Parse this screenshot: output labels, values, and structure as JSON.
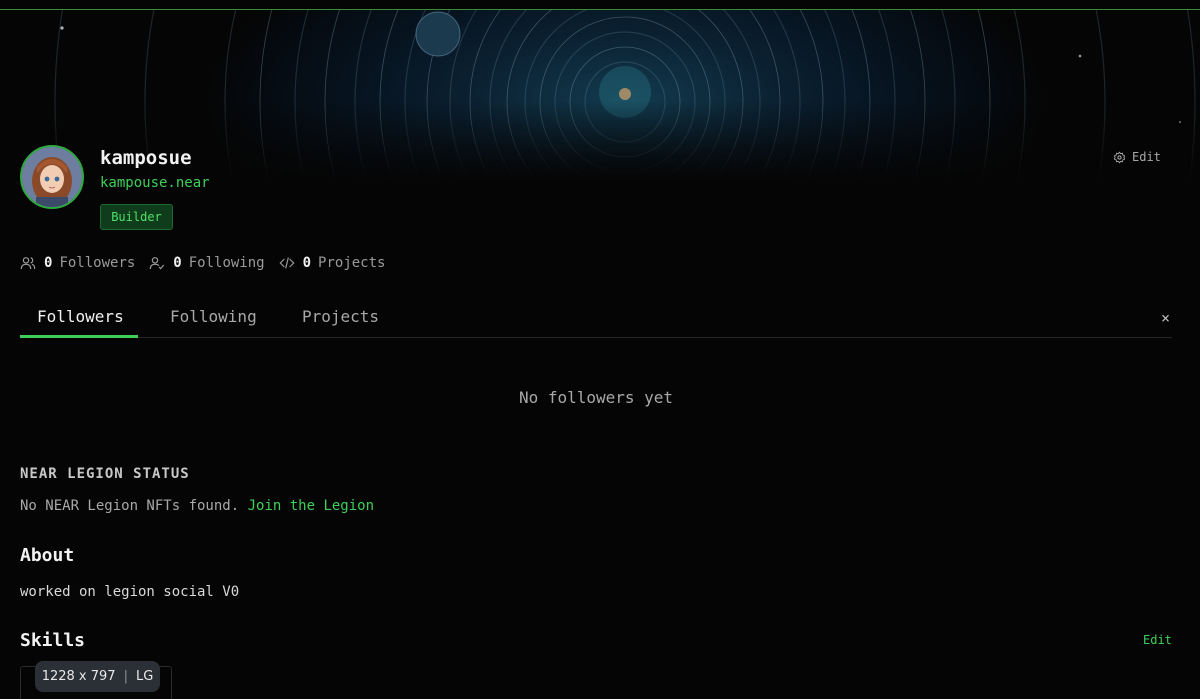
{
  "profile": {
    "username": "kamposue",
    "account_id": "kampouse.near",
    "badge": "Builder",
    "edit_label": "Edit"
  },
  "stats": {
    "followers_count": "0",
    "followers_label": "Followers",
    "following_count": "0",
    "following_label": "Following",
    "projects_count": "0",
    "projects_label": "Projects"
  },
  "tabs": [
    {
      "label": "Followers",
      "active": true
    },
    {
      "label": "Following",
      "active": false
    },
    {
      "label": "Projects",
      "active": false
    }
  ],
  "tab_panel": {
    "close_label": "×",
    "empty_message": "No followers yet"
  },
  "legion": {
    "heading": "NEAR LEGION STATUS",
    "message": "No NEAR Legion NFTs found.",
    "join_link": "Join the Legion"
  },
  "about": {
    "heading": "About",
    "text": "worked on legion social V0"
  },
  "skills": {
    "heading": "Skills",
    "edit_label": "Edit"
  },
  "viewport_indicator": {
    "size": "1228 x 797",
    "separator": "|",
    "breakpoint": "LG"
  },
  "colors": {
    "accent": "#3ecf5a",
    "background": "#050505",
    "badge_bg": "#0f3d1c"
  }
}
